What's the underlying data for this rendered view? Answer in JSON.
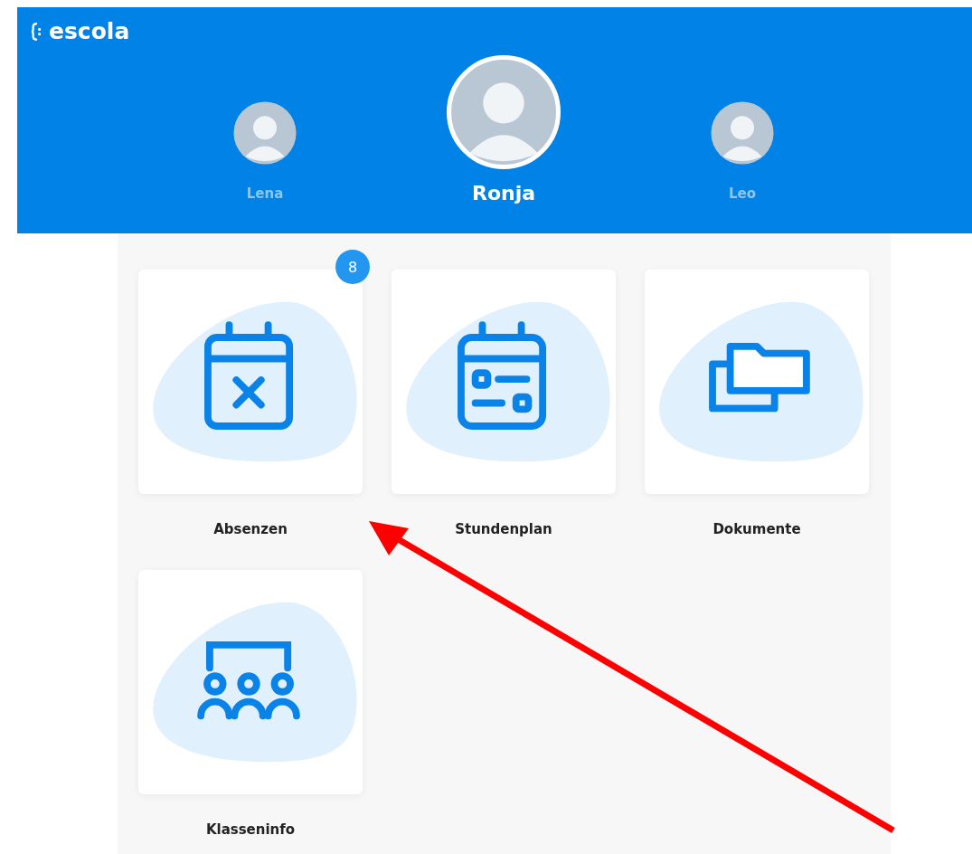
{
  "header": {
    "logo": "escola"
  },
  "children": [
    {
      "name": "Lena",
      "selected": false
    },
    {
      "name": "Ronja",
      "selected": true
    },
    {
      "name": "Leo",
      "selected": false
    }
  ],
  "tiles": [
    {
      "label": "Absenzen",
      "kind": "absences",
      "badge": "8"
    },
    {
      "label": "Stundenplan",
      "kind": "timetable"
    },
    {
      "label": "Dokumente",
      "kind": "documents"
    },
    {
      "label": "Klasseninfo",
      "kind": "class"
    }
  ]
}
